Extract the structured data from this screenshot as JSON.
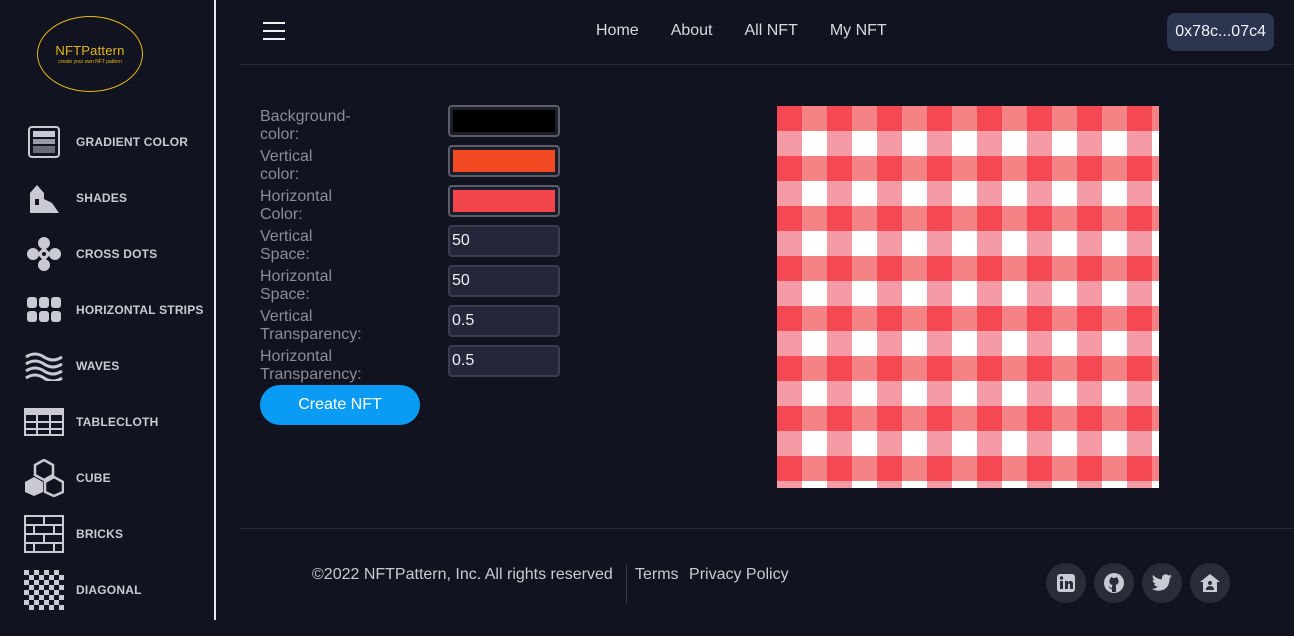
{
  "brand": {
    "name": "NFTPattern",
    "tagline": "create your own NFT pattern"
  },
  "sidebar": {
    "items": [
      {
        "label": "GRADIENT COLOR",
        "icon": "gradient-icon"
      },
      {
        "label": "SHADES",
        "icon": "shades-icon"
      },
      {
        "label": "CROSS DOTS",
        "icon": "cross-dots-icon"
      },
      {
        "label": "HORIZONTAL STRIPS",
        "icon": "horizontal-strips-icon"
      },
      {
        "label": "WAVES",
        "icon": "waves-icon"
      },
      {
        "label": "TABLECLOTH",
        "icon": "tablecloth-icon"
      },
      {
        "label": "CUBE",
        "icon": "cube-icon"
      },
      {
        "label": "BRICKS",
        "icon": "bricks-icon"
      },
      {
        "label": "DIAGONAL",
        "icon": "diagonal-icon"
      }
    ]
  },
  "header": {
    "nav": [
      "Home",
      "About",
      "All NFT",
      "My NFT"
    ],
    "wallet": "0x78c...07c4"
  },
  "form": {
    "fields": [
      {
        "label": "Background-color:",
        "type": "color",
        "value": "#000000"
      },
      {
        "label": "Vertical color:",
        "type": "color",
        "value": "#f24a23"
      },
      {
        "label": "Horizontal Color:",
        "type": "color",
        "value": "#f2464c"
      },
      {
        "label": "Vertical Space:",
        "type": "number",
        "value": "50"
      },
      {
        "label": "Horizontal Space:",
        "type": "number",
        "value": "50"
      },
      {
        "label": "Vertical Transparency:",
        "type": "number",
        "value": "0.5"
      },
      {
        "label": "Horizontal Transparency:",
        "type": "number",
        "value": "0.5"
      }
    ],
    "submit": "Create NFT"
  },
  "preview": {
    "dark": "#f44852",
    "mid_a": "#f58284",
    "mid_b": "#f59ba5",
    "light": "#ffffff"
  },
  "footer": {
    "copyright": "©2022 NFTPattern, Inc. All rights reserved",
    "links": [
      "Terms",
      "Privacy Policy"
    ],
    "social": [
      "linkedin-icon",
      "github-icon",
      "twitter-icon",
      "home-icon"
    ]
  }
}
